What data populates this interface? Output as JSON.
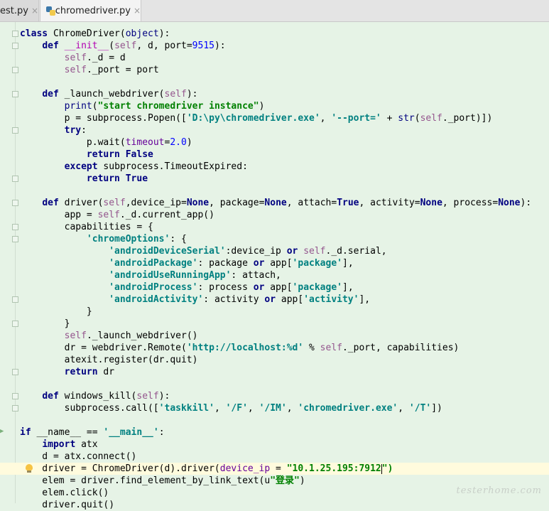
{
  "tabs": [
    {
      "label": "est.py",
      "active": false
    },
    {
      "label": "chromedriver.py",
      "active": true
    }
  ],
  "tab_close_glyph": "×",
  "watermark": "testerhome.com",
  "colors": {
    "editor_background": "#e6f3e6",
    "keyword": "#000080",
    "string": "#008080",
    "self": "#94558d",
    "number": "#0000ff",
    "param": "#660099",
    "current_line": "#fffbdd"
  },
  "code": {
    "l1": [
      "class",
      " ChromeDriver(",
      "object",
      "):"
    ],
    "l2": [
      "    ",
      "def",
      " ",
      "__init__",
      "(",
      "self",
      ", d, port=",
      "9515",
      "):"
    ],
    "l3": [
      "        ",
      "self",
      "._d = d"
    ],
    "l4": [
      "        ",
      "self",
      "._port = port"
    ],
    "l6": [
      "    ",
      "def",
      " _launch_webdriver(",
      "self",
      "):"
    ],
    "l7": [
      "        ",
      "print",
      "(",
      "\"start chromedriver instance\"",
      ")"
    ],
    "l8": [
      "        p = subprocess.Popen([",
      "'D:\\py\\chromedriver.exe'",
      ", ",
      "'--port='",
      " + ",
      "str",
      "(",
      "self",
      "._port)])"
    ],
    "l9": [
      "        ",
      "try",
      ":"
    ],
    "l10": [
      "            p.wait(",
      "timeout",
      "=",
      "2.0",
      ")"
    ],
    "l11": [
      "            ",
      "return False"
    ],
    "l12": [
      "        ",
      "except",
      " subprocess.TimeoutExpired:"
    ],
    "l13": [
      "            ",
      "return True"
    ],
    "l15": [
      "    ",
      "def",
      " driver(",
      "self",
      ",device_ip=",
      "None",
      ", package=",
      "None",
      ", attach=",
      "True",
      ", activity=",
      "None",
      ", process=",
      "None",
      "):"
    ],
    "l16": [
      "        app = ",
      "self",
      "._d.current_app()"
    ],
    "l17": [
      "        capabilities = {"
    ],
    "l18": [
      "            ",
      "'chromeOptions'",
      ": {"
    ],
    "l19": [
      "                ",
      "'androidDeviceSerial'",
      ":device_ip ",
      "or",
      " ",
      "self",
      "._d.serial,"
    ],
    "l20": [
      "                ",
      "'androidPackage'",
      ": package ",
      "or",
      " app[",
      "'package'",
      "],"
    ],
    "l21": [
      "                ",
      "'androidUseRunningApp'",
      ": attach,"
    ],
    "l22": [
      "                ",
      "'androidProcess'",
      ": process ",
      "or",
      " app[",
      "'package'",
      "],"
    ],
    "l23": [
      "                ",
      "'androidActivity'",
      ": activity ",
      "or",
      " app[",
      "'activity'",
      "],"
    ],
    "l24": [
      "            }"
    ],
    "l25": [
      "        }"
    ],
    "l26": [
      "        ",
      "self",
      "._launch_webdriver()"
    ],
    "l27": [
      "        dr = webdriver.Remote(",
      "'http://localhost:%d'",
      " % ",
      "self",
      "._port, capabilities)"
    ],
    "l28": [
      "        atexit.register(dr.quit)"
    ],
    "l29": [
      "        ",
      "return",
      " dr"
    ],
    "l31": [
      "    ",
      "def",
      " windows_kill(",
      "self",
      "):"
    ],
    "l32": [
      "        subprocess.call([",
      "'taskkill'",
      ", ",
      "'/F'",
      ", ",
      "'/IM'",
      ", ",
      "'chromedriver.exe'",
      ", ",
      "'/T'",
      "])"
    ],
    "l34": [
      "if",
      " __name__ == ",
      "'__main__'",
      ":"
    ],
    "l35": [
      "    ",
      "import",
      " atx"
    ],
    "l36": [
      "    d = atx.connect()"
    ],
    "l37": [
      "    driver = ChromeDriver(d).driver(",
      "device_ip",
      " = ",
      "\"10.1.25.195:7912",
      "\")"
    ],
    "l38": [
      "    elem = driver.find_element_by_link_text(u",
      "\"登录\"",
      ")"
    ],
    "l39": [
      "    elem.click()"
    ],
    "l40": [
      "    driver.quit()"
    ]
  }
}
